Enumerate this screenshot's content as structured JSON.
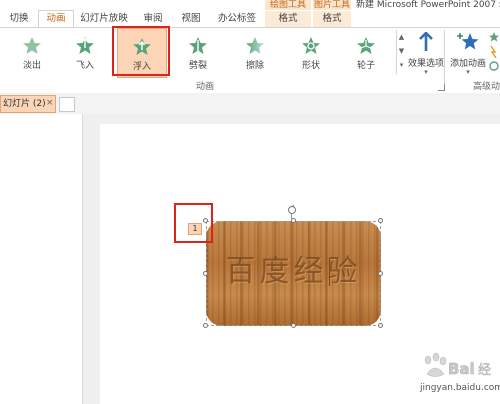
{
  "title_bar": {
    "context_drawing": "绘图工具",
    "context_picture": "图片工具",
    "window_title": "新建 Microsoft PowerPoint 2007 幻"
  },
  "tabs": [
    "切换",
    "动画",
    "幻灯片放映",
    "审阅",
    "视图",
    "办公标签",
    "格式",
    "格式"
  ],
  "animations": [
    {
      "label": "淡出",
      "icon": "fade-star-icon"
    },
    {
      "label": "飞入",
      "icon": "fly-in-star-icon"
    },
    {
      "label": "浮入",
      "icon": "float-in-star-icon"
    },
    {
      "label": "劈裂",
      "icon": "split-star-icon"
    },
    {
      "label": "擦除",
      "icon": "wipe-star-icon"
    },
    {
      "label": "形状",
      "icon": "shape-star-icon"
    },
    {
      "label": "轮子",
      "icon": "wheel-star-icon"
    }
  ],
  "ribbon": {
    "effect_options": "效果选项",
    "add_animation": "添加动画",
    "animation_group": "动画",
    "advanced_group": "高级动"
  },
  "doc_tab": {
    "label": "幻灯片 (2)",
    "close": "×"
  },
  "slide": {
    "shape_text": "百度经验",
    "anim_order": "1"
  },
  "watermark": {
    "logo_text": "Bai 经验",
    "url": "jingyan.baidu.com"
  },
  "colors": {
    "accent": "#c2681a",
    "highlight_red": "#e0211c",
    "star_green": "#5aa37a"
  }
}
